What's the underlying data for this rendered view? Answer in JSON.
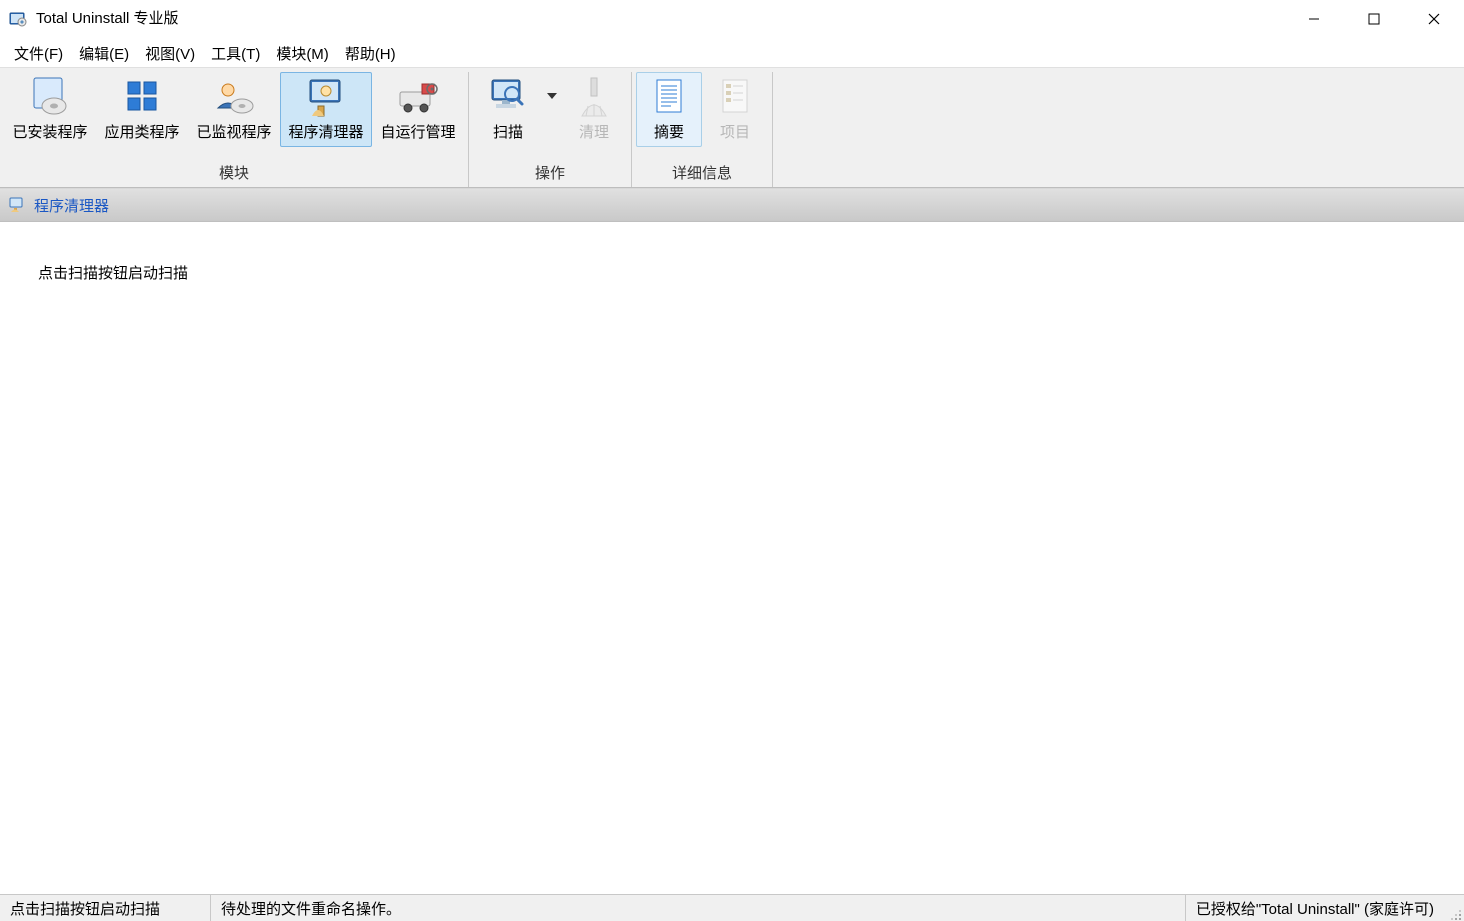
{
  "window": {
    "title": "Total Uninstall 专业版"
  },
  "menu": {
    "file": "文件(F)",
    "edit": "编辑(E)",
    "view": "视图(V)",
    "tools": "工具(T)",
    "modules": "模块(M)",
    "help": "帮助(H)"
  },
  "ribbon": {
    "group_modules": {
      "label": "模块",
      "installed": "已安装程序",
      "app_type": "应用类程序",
      "monitored": "已监视程序",
      "cleaner": "程序清理器",
      "autorun": "自运行管理"
    },
    "group_operations": {
      "label": "操作",
      "scan": "扫描",
      "clean": "清理"
    },
    "group_details": {
      "label": "详细信息",
      "summary": "摘要",
      "items": "项目"
    }
  },
  "section": {
    "title": "程序清理器"
  },
  "content": {
    "prompt": "点击扫描按钮启动扫描"
  },
  "status": {
    "left": "点击扫描按钮启动扫描",
    "middle": "待处理的文件重命名操作。",
    "right": "已授权给\"Total Uninstall\" (家庭许可)"
  }
}
